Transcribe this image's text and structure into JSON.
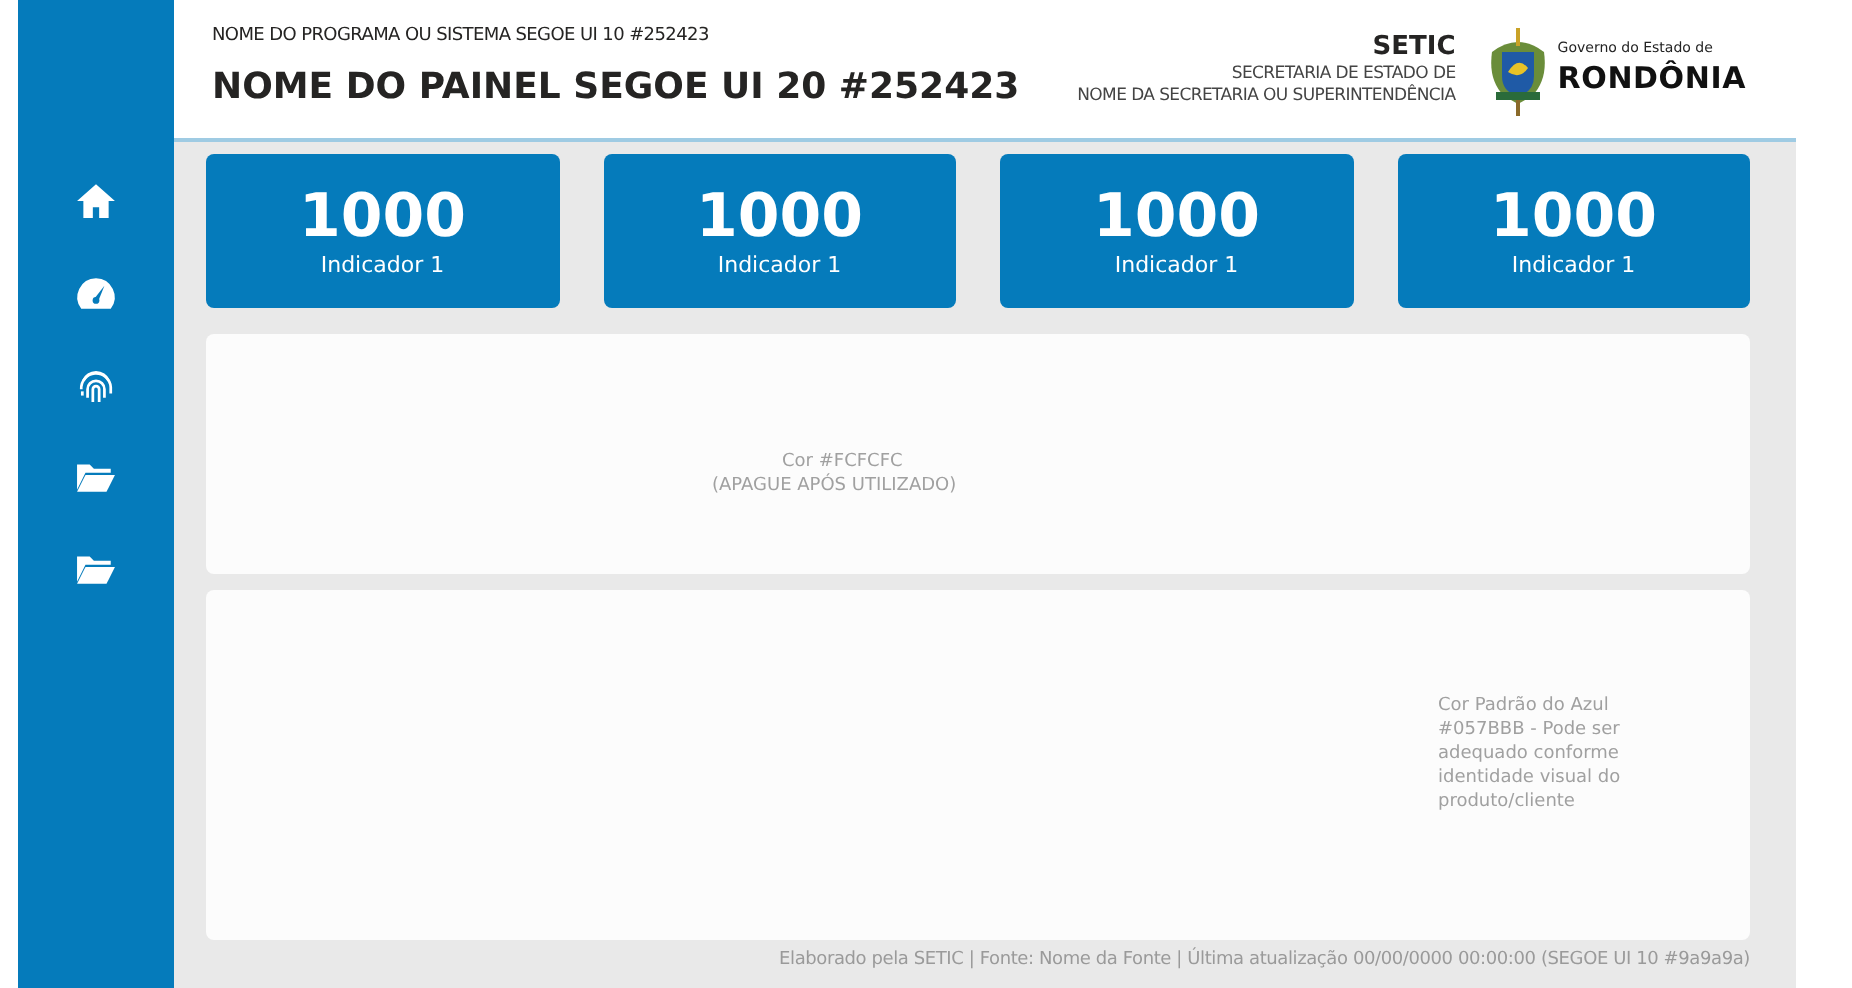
{
  "sidebar": {
    "items": [
      {
        "kind": "home"
      },
      {
        "kind": "gauge"
      },
      {
        "kind": "fingerprint"
      },
      {
        "kind": "folder"
      },
      {
        "kind": "folder"
      }
    ]
  },
  "header": {
    "program_name": "NOME DO PROGRAMA OU SISTEMA SEGOE UI 10 #252423",
    "panel_title": "NOME DO PAINEL SEGOE UI 20 #252423",
    "org": "SETIC",
    "org_line_1": "SECRETARIA DE ESTADO DE",
    "org_line_2": "NOME DA SECRETARIA OU SUPERINTENDÊNCIA",
    "logo_caption": "Governo do Estado de",
    "logo_state": "RONDÔNIA"
  },
  "indicators": [
    {
      "value": "1000",
      "label": "Indicador 1"
    },
    {
      "value": "1000",
      "label": "Indicador 1"
    },
    {
      "value": "1000",
      "label": "Indicador 1"
    },
    {
      "value": "1000",
      "label": "Indicador 1"
    }
  ],
  "panel_1": {
    "note_line_1": "Cor #FCFCFC",
    "note_line_2": "(APAGUE APÓS UTILIZADO)"
  },
  "panel_2": {
    "note": "Cor Padrão do Azul #057BBB - Pode ser adequado conforme identidade visual do produto/cliente"
  },
  "footer": "Elaborado pela SETIC | Fonte: Nome da Fonte | Última atualização 00/00/0000 00:00:00 (SEGOE UI 10 #9a9a9a)"
}
